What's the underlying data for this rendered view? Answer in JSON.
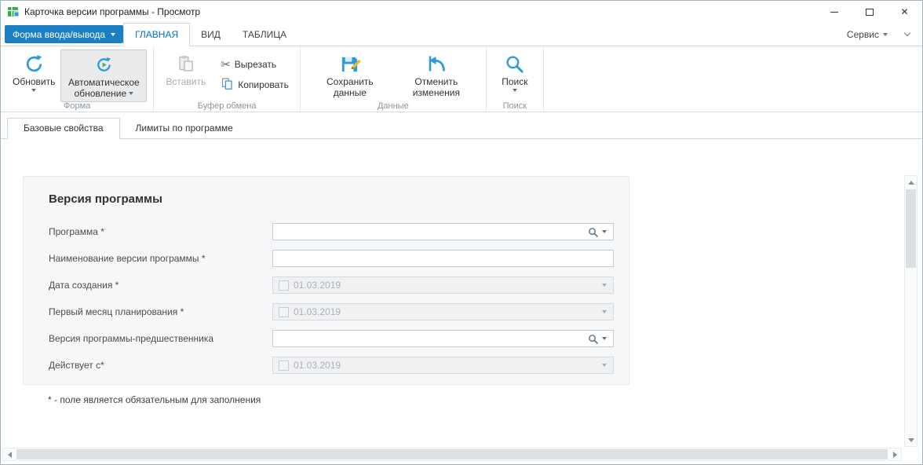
{
  "colors": {
    "accent_blue": "#1b7fc4",
    "active_tab_text": "#0072c6",
    "icon_blue": "#2d9bd8"
  },
  "titlebar": {
    "title": "Карточка версии программы - Просмотр"
  },
  "ribbon": {
    "app_menu_label": "Форма ввода/вывода",
    "tabs": [
      {
        "label": "ГЛАВНАЯ",
        "active": true
      },
      {
        "label": "ВИД",
        "active": false
      },
      {
        "label": "ТАБЛИЦА",
        "active": false
      }
    ],
    "service_label": "Сервис",
    "groups": {
      "forma": {
        "label": "Форма",
        "refresh": "Обновить",
        "auto_refresh": "Автоматическое обновление"
      },
      "clipboard": {
        "label": "Буфер обмена",
        "paste": "Вставить",
        "cut": "Вырезать",
        "copy": "Копировать"
      },
      "data": {
        "label": "Данные",
        "save": "Сохранить данные",
        "undo": "Отменить изменения"
      },
      "search": {
        "label": "Поиск",
        "search": "Поиск"
      }
    }
  },
  "doc_tabs": [
    {
      "label": "Базовые свойства",
      "active": true
    },
    {
      "label": "Лимиты по программе",
      "active": false
    }
  ],
  "form": {
    "title": "Версия программы",
    "fields": [
      {
        "label": "Программа *",
        "type": "lookup",
        "value": "",
        "disabled": false
      },
      {
        "label": "Наименование версии программы *",
        "type": "text",
        "value": "",
        "disabled": false
      },
      {
        "label": "Дата создания *",
        "type": "date",
        "value": "01.03.2019",
        "disabled": true
      },
      {
        "label": "Первый месяц планирования *",
        "type": "date",
        "value": "01.03.2019",
        "disabled": true
      },
      {
        "label": "Версия программы-предшественника",
        "type": "lookup",
        "value": "",
        "disabled": false
      },
      {
        "label": "Действует с*",
        "type": "date",
        "value": "01.03.2019",
        "disabled": true
      }
    ],
    "footnote": "* - поле является обязательным для заполнения"
  }
}
